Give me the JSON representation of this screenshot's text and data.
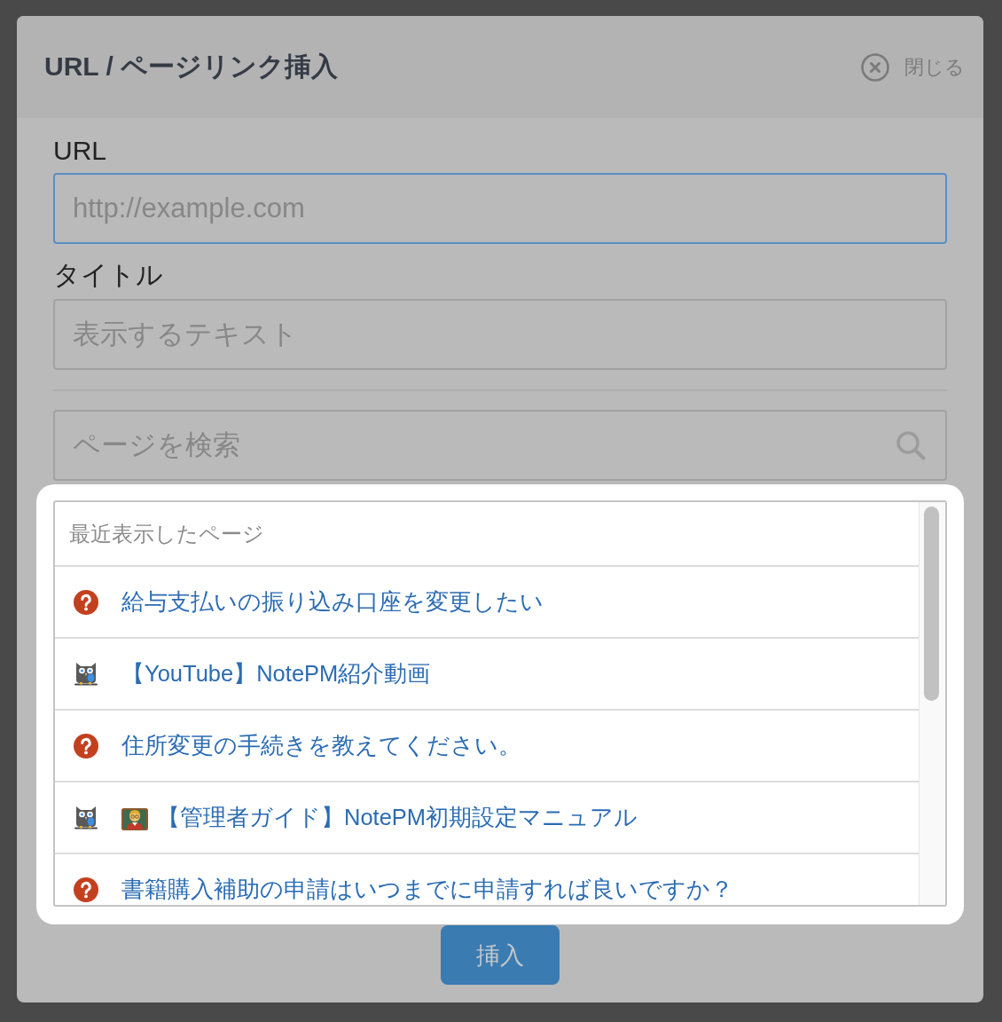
{
  "dialog": {
    "title": "URL / ページリンク挿入",
    "close_label": "閉じる"
  },
  "fields": [
    {
      "label": "URL",
      "placeholder": "http://example.com",
      "focused": true
    },
    {
      "label": "タイトル",
      "placeholder": "表示するテキスト",
      "focused": false
    }
  ],
  "search": {
    "placeholder": "ページを検索"
  },
  "recent_pages": {
    "heading": "最近表示したページ",
    "items": [
      {
        "icons": [
          {
            "kind": "question"
          }
        ],
        "title": "給与支払いの振り込み口座を変更したい"
      },
      {
        "icons": [
          {
            "kind": "owl"
          }
        ],
        "title": "【YouTube】NotePM紹介動画"
      },
      {
        "icons": [
          {
            "kind": "question"
          }
        ],
        "title": "住所変更の手続きを教えてください。"
      },
      {
        "icons": [
          {
            "kind": "owl"
          },
          {
            "kind": "teacher"
          }
        ],
        "title": "【管理者ガイド】NotePM初期設定マニュアル"
      },
      {
        "icons": [
          {
            "kind": "question"
          }
        ],
        "title": "書籍購入補助の申請はいつまでに申請すれば良いですか？"
      }
    ]
  },
  "insert_button": {
    "label": "挿入"
  }
}
